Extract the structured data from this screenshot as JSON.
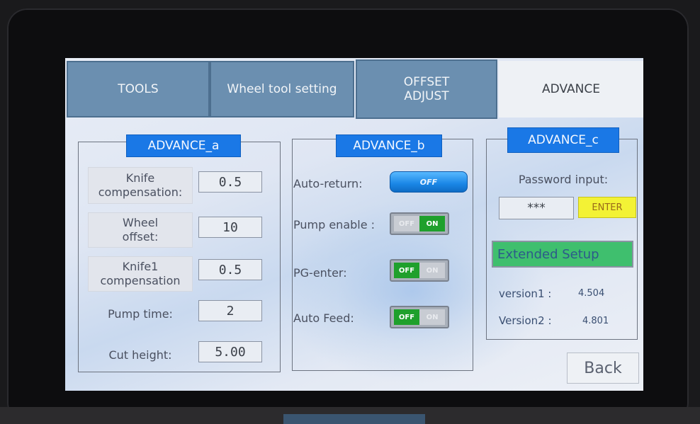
{
  "tabs": [
    {
      "label": "TOOLS"
    },
    {
      "label": "Wheel tool setting"
    },
    {
      "label": "OFFSET\nADJUST"
    },
    {
      "label": "ADVANCE"
    }
  ],
  "advance_a": {
    "title": "ADVANCE_a",
    "rows": [
      {
        "label": "Knife\ncompensation:",
        "value": "0.5"
      },
      {
        "label": "Wheel\noffset:",
        "value": "10"
      },
      {
        "label": "Knife1\ncompensation",
        "value": "0.5"
      },
      {
        "label": "Pump time:",
        "value": "2"
      },
      {
        "label": "Cut height:",
        "value": "5.00"
      }
    ]
  },
  "advance_b": {
    "title": "ADVANCE_b",
    "auto_return": {
      "label": "Auto-return:",
      "state": "OFF"
    },
    "pump_enable": {
      "label": "Pump enable :",
      "off": "OFF",
      "on": "ON",
      "active": "ON"
    },
    "pg_enter": {
      "label": "PG-enter:",
      "off": "OFF",
      "on": "ON",
      "active": "OFF"
    },
    "auto_feed": {
      "label": "Auto Feed:",
      "off": "OFF",
      "on": "ON",
      "active": "OFF"
    }
  },
  "advance_c": {
    "title": "ADVANCE_c",
    "password_label": "Password input:",
    "password_value": "***",
    "enter_label": "ENTER",
    "extended_label": "Extended Setup",
    "version1_label": "version1 :",
    "version1_value": "4.504",
    "version2_label": "Version2 :",
    "version2_value": "4.801"
  },
  "back_label": "Back",
  "colors": {
    "tab_inactive": "#6b8fb0",
    "panel_title": "#1a78e6",
    "toggle_on": "#1fa02c",
    "enter_button": "#f3f235",
    "extended_button": "#3fbf6e"
  }
}
